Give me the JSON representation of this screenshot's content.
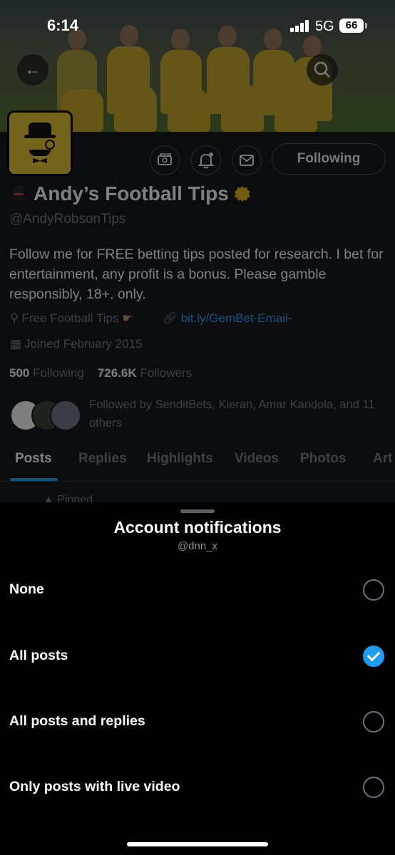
{
  "status": {
    "time": "6:14",
    "network": "5G",
    "battery": "66"
  },
  "profile": {
    "follow_label": "Following",
    "name": "Andy’s Football Tips",
    "handle": "@AndyRobsonTips",
    "bio": "Follow me for FREE betting tips posted for research. I bet for entertainment, any profit is a bonus. Please gamble responsibly, 18+. only.",
    "location": "Free Football Tips",
    "link": "bit.ly/GemBet-Email-",
    "joined": "Joined February 2015",
    "following_count": "500",
    "following_label": "Following",
    "followers_count": "726.6K",
    "followers_label": "Followers",
    "followed_by": "Followed by SenditBets, Kieran, Amar Kandola, and 11 others",
    "tabs": [
      "Posts",
      "Replies",
      "Highlights",
      "Videos",
      "Photos",
      "Art"
    ],
    "pinned_label": "Pinned"
  },
  "sheet": {
    "title": "Account notifications",
    "account": "@dnn_x",
    "options": [
      {
        "label": "None",
        "selected": false
      },
      {
        "label": "All posts",
        "selected": true
      },
      {
        "label": "All posts and replies",
        "selected": false
      },
      {
        "label": "Only posts with live video",
        "selected": false
      }
    ]
  },
  "colors": {
    "accent": "#1d9bf0",
    "verified": "#d4a419",
    "sheet_bg": "#000000"
  },
  "icons": [
    "back-arrow-icon",
    "search-icon",
    "tip-jar-icon",
    "notification-bell-icon",
    "mail-icon",
    "location-pin-icon",
    "link-icon",
    "calendar-icon",
    "pin-icon"
  ]
}
